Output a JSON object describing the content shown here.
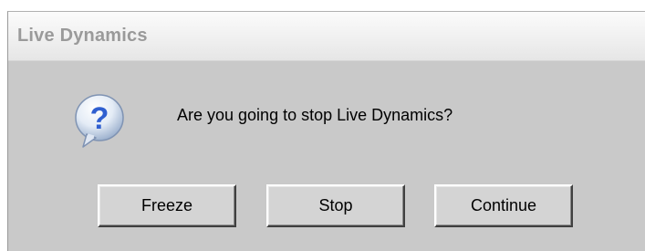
{
  "window": {
    "title": "Live Dynamics"
  },
  "dialog": {
    "icon": "question-icon",
    "message": "Are you going to stop Live Dynamics?"
  },
  "buttons": {
    "freeze": "Freeze",
    "stop": "Stop",
    "continue": "Continue"
  },
  "colors": {
    "dialog_background": "#c9c9c9",
    "title_text": "#9a9a9a",
    "icon_blue": "#2f5fd0"
  }
}
